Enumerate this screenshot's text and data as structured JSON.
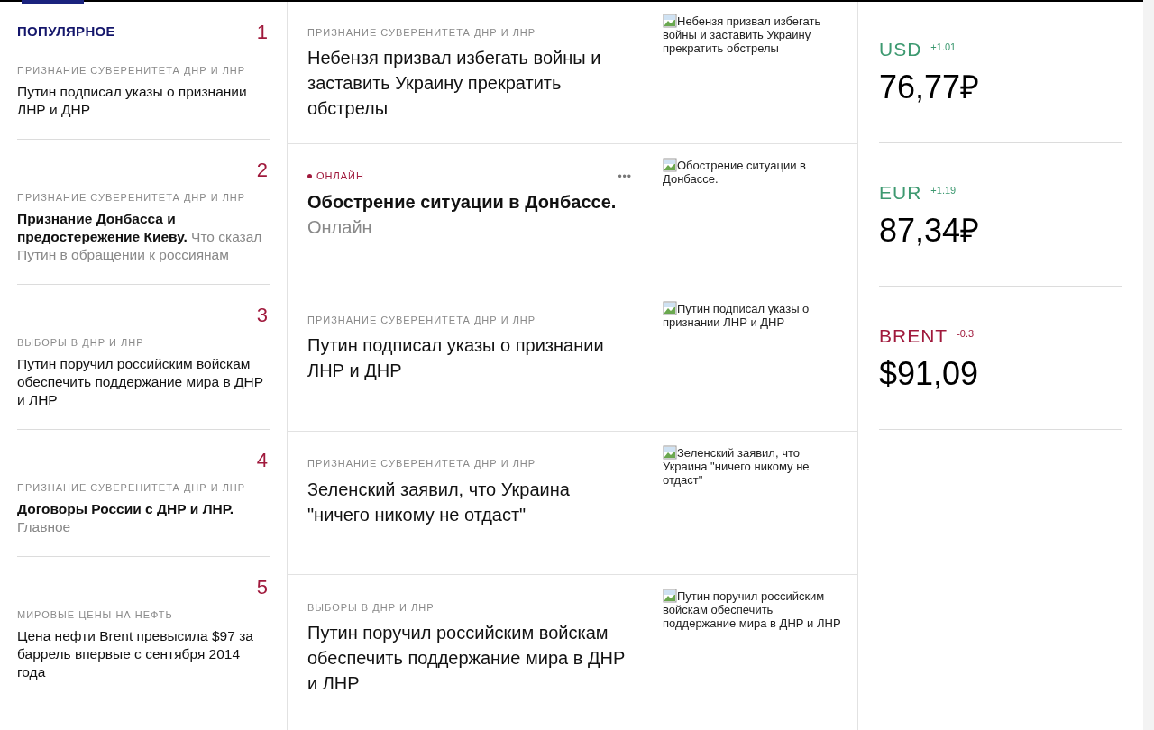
{
  "popular": {
    "heading": "ПОПУЛЯРНОЕ",
    "items": [
      {
        "number": "1",
        "rubric": "ПРИЗНАНИЕ СУВЕРЕНИТЕТА ДНР И ЛНР",
        "kind": "plain",
        "title": "Путин подписал указы о признании ЛНР и ДНР"
      },
      {
        "number": "2",
        "rubric": "ПРИЗНАНИЕ СУВЕРЕНИТЕТА ДНР И ЛНР",
        "kind": "lead",
        "title": "**Признание Донбасса и предостережение Киеву.** Что сказал Путин в обращении к россиянам"
      },
      {
        "number": "3",
        "rubric": "ВЫБОРЫ В ДНР И ЛНР",
        "kind": "plain",
        "title": "Путин поручил российским войскам обеспечить поддержание мира в ДНР и ЛНР"
      },
      {
        "number": "4",
        "rubric": "ПРИЗНАНИЕ СУВЕРЕНИТЕТА ДНР И ЛНР",
        "kind": "lead",
        "title": "**Договоры России с ДНР и ЛНР.** Главное"
      },
      {
        "number": "5",
        "rubric": "МИРОВЫЕ ЦЕНЫ НА НЕФТЬ",
        "kind": "plain",
        "title": "Цена нефти Brent превысила $97 за баррель впервые с сентября 2014 года"
      }
    ]
  },
  "feed": [
    {
      "kind": "rubric",
      "label": "ПРИЗНАНИЕ СУВЕРЕНИТЕТА ДНР И ЛНР",
      "title": "Небензя призвал избегать войны и заставить Украину прекратить обстрелы",
      "image_alt": "Небензя призвал избегать войны и заставить Украину прекратить обстрелы"
    },
    {
      "kind": "live",
      "label": "ОНЛАЙН",
      "more": "•••",
      "title": "**Обострение ситуации в Донбассе.** Онлайн",
      "image_alt": "Обострение ситуации в Донбассе."
    },
    {
      "kind": "rubric",
      "label": "ПРИЗНАНИЕ СУВЕРЕНИТЕТА ДНР И ЛНР",
      "title": "Путин подписал указы о признании ЛНР и ДНР",
      "image_alt": "Путин подписал указы о признании ЛНР и ДНР"
    },
    {
      "kind": "rubric",
      "label": "ПРИЗНАНИЕ СУВЕРЕНИТЕТА ДНР И ЛНР",
      "title": "Зеленский заявил, что Украина \"ничего никому не отдаст\"",
      "image_alt": "Зеленский заявил, что Украина \"ничего никому не отдаст\""
    },
    {
      "kind": "rubric",
      "label": "ВЫБОРЫ В ДНР И ЛНР",
      "title": "Путин поручил российским войскам обеспечить поддержание мира в ДНР и ЛНР",
      "image_alt": "Путин поручил российским войскам обеспечить поддержание мира в ДНР и ЛНР"
    }
  ],
  "rates": [
    {
      "name": "USD",
      "change": "+1.01",
      "color": "#3d9970",
      "value": "76,77₽"
    },
    {
      "name": "EUR",
      "change": "+1.19",
      "color": "#3d9970",
      "value": "87,34₽"
    },
    {
      "name": "BRENT",
      "change": "-0.3",
      "color": "#a0193c",
      "value": "$91,09"
    }
  ]
}
